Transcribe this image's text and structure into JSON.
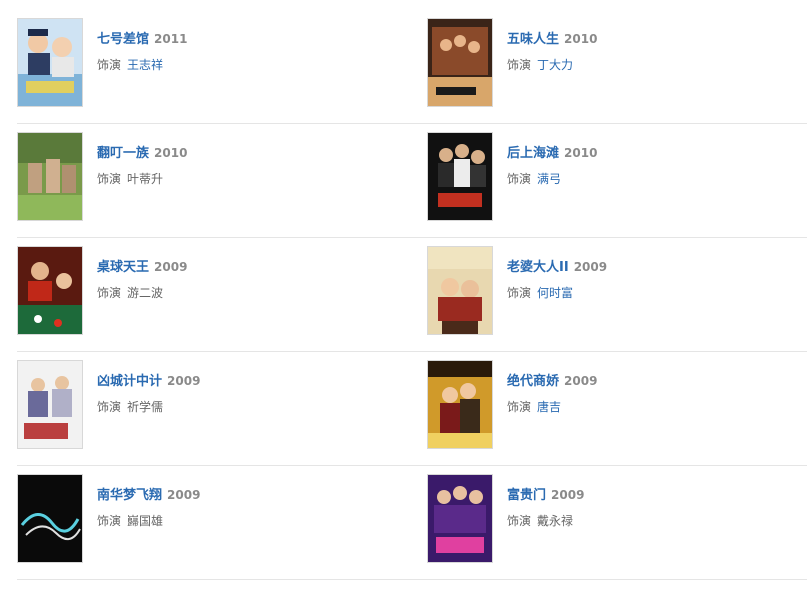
{
  "cast_label": "饰演",
  "rows": [
    {
      "left": {
        "title": "七号差馆",
        "year": "2011",
        "actor": "王志祥",
        "actor_link": true
      },
      "right": {
        "title": "五味人生",
        "year": "2010",
        "actor": "丁大力",
        "actor_link": true
      }
    },
    {
      "left": {
        "title": "翻叮一族",
        "year": "2010",
        "actor": "叶蒂升",
        "actor_link": false
      },
      "right": {
        "title": "后上海滩",
        "year": "2010",
        "actor": "满弓",
        "actor_link": true
      }
    },
    {
      "left": {
        "title": "桌球天王",
        "year": "2009",
        "actor": "游二波",
        "actor_link": false
      },
      "right": {
        "title": "老婆大人II",
        "year": "2009",
        "actor": "何时富",
        "actor_link": true
      }
    },
    {
      "left": {
        "title": "凶城计中计",
        "year": "2009",
        "actor": "祈学儒",
        "actor_link": false
      },
      "right": {
        "title": "绝代商娇",
        "year": "2009",
        "actor": "唐吉",
        "actor_link": true
      }
    },
    {
      "left": {
        "title": "南华梦飞翔",
        "year": "2009",
        "actor": "巋国雄",
        "actor_link": false
      },
      "right": {
        "title": "富贵门",
        "year": "2009",
        "actor": "戴永禄",
        "actor_link": false
      }
    }
  ],
  "colors": {
    "link": "#2a6ab1",
    "year": "#8a8a8a",
    "text": "#666666",
    "divider": "#e5e5e5"
  }
}
